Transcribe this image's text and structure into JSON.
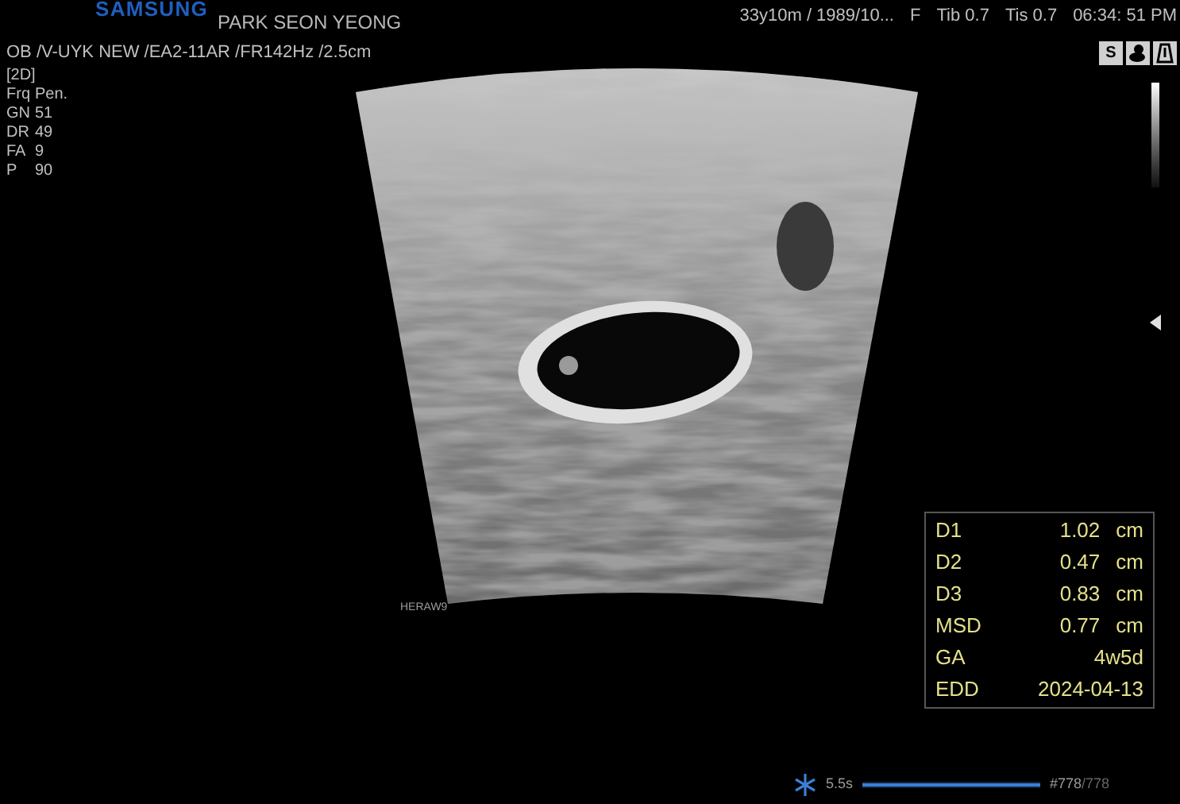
{
  "header": {
    "logo": "SAMSUNG",
    "patient_name": "PARK SEON YEONG",
    "patient_info": "33y10m / 1989/10...",
    "sex": "F",
    "tib": "Tib 0.7",
    "tis": "Tis 0.7",
    "time": "06:34: 51 PM"
  },
  "status_icons": [
    {
      "kind": "letter",
      "label": "S"
    },
    {
      "kind": "baby"
    },
    {
      "kind": "probe"
    }
  ],
  "probe_line": "OB /V-UYK NEW /EA2-11AR /FR142Hz /2.5cm",
  "mode": "[2D]",
  "params": [
    {
      "name": "Frq",
      "value": "Pen."
    },
    {
      "name": "GN",
      "value": "51"
    },
    {
      "name": "DR",
      "value": "49"
    },
    {
      "name": "FA",
      "value": "9"
    },
    {
      "name": "P",
      "value": "90"
    }
  ],
  "image_label": "HERAW9",
  "measurements": [
    {
      "name": "D1",
      "value": "1.02",
      "unit": "cm"
    },
    {
      "name": "D2",
      "value": "0.47",
      "unit": "cm"
    },
    {
      "name": "D3",
      "value": "0.83",
      "unit": "cm"
    },
    {
      "name": "MSD",
      "value": "0.77",
      "unit": "cm"
    },
    {
      "name": "GA",
      "value": "4w5d"
    },
    {
      "name": "EDD",
      "value": "2024-04-13"
    }
  ],
  "cine": {
    "duration": "5.5s",
    "level": 1,
    "frame": "#778",
    "total": "/778"
  }
}
